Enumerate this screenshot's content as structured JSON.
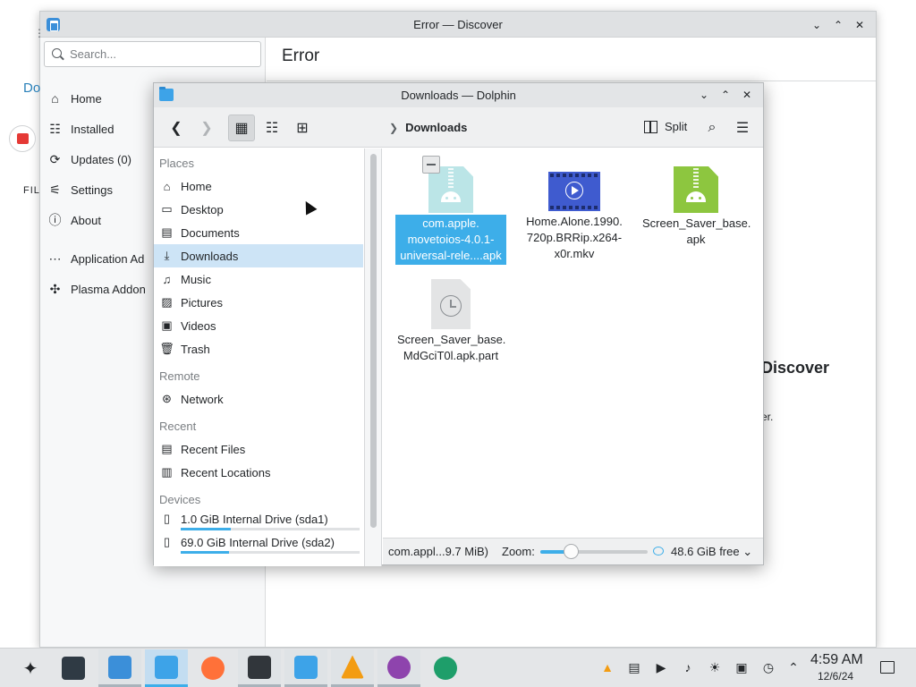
{
  "discover": {
    "title": "Error — Discover",
    "search_placeholder": "Search...",
    "header_title": "Error",
    "nav": [
      {
        "label": "Home",
        "icon": "home-icon"
      },
      {
        "label": "Installed",
        "icon": "installed-list-icon"
      },
      {
        "label": "Updates (0)",
        "icon": "updates-icon"
      },
      {
        "label": "Settings",
        "icon": "settings-icon"
      },
      {
        "label": "About",
        "icon": "about-icon"
      },
      {
        "label": "Application Ad",
        "icon": "application-addons-icon"
      },
      {
        "label": "Plasma Addon",
        "icon": "plasma-addons-icon"
      }
    ],
    "partial_left_text": "Do",
    "partial_fil_text": "FIL",
    "error_title_partial": "Discover",
    "error_sub_partial": "er."
  },
  "dolphin": {
    "title": "Downloads — Dolphin",
    "breadcrumb": "Downloads",
    "split_label": "Split",
    "places": {
      "sections": [
        "Places",
        "Remote",
        "Recent",
        "Devices"
      ],
      "places_items": [
        {
          "label": "Home",
          "icon": "home-icon"
        },
        {
          "label": "Desktop",
          "icon": "desktop-icon"
        },
        {
          "label": "Documents",
          "icon": "documents-icon"
        },
        {
          "label": "Downloads",
          "icon": "download-icon",
          "selected": true
        },
        {
          "label": "Music",
          "icon": "music-icon"
        },
        {
          "label": "Pictures",
          "icon": "pictures-icon"
        },
        {
          "label": "Videos",
          "icon": "videos-icon"
        },
        {
          "label": "Trash",
          "icon": "trash-icon"
        }
      ],
      "remote_items": [
        {
          "label": "Network",
          "icon": "network-icon"
        }
      ],
      "recent_items": [
        {
          "label": "Recent Files",
          "icon": "recent-files-icon"
        },
        {
          "label": "Recent Locations",
          "icon": "recent-locations-icon"
        }
      ],
      "devices": [
        {
          "label": "1.0 GiB Internal Drive (sda1)",
          "usage_fraction": 0.28
        },
        {
          "label": "69.0 GiB Internal Drive (sda2)",
          "usage_fraction": 0.27
        }
      ]
    },
    "files": [
      {
        "name": "com.apple.\nmovetoios-4.0.1-\nuniversal-rele....apk",
        "type": "apk",
        "selected": true
      },
      {
        "name": "Home.Alone.1990.\n720p.BRRip.x264-\nx0r.mkv",
        "type": "video"
      },
      {
        "name": "Screen_Saver_base.\napk",
        "type": "apk"
      },
      {
        "name": "Screen_Saver_base.\nMdGciT0l.apk.part",
        "type": "part"
      }
    ],
    "status": {
      "selection_info": "com.appl...9.7 MiB)",
      "zoom_label": "Zoom:",
      "zoom_fraction": 0.28,
      "free_space": "48.6 GiB free"
    }
  },
  "taskbar": {
    "apps": [
      {
        "name": "application-launcher-icon"
      },
      {
        "name": "system-settings-icon"
      },
      {
        "name": "discover-icon"
      },
      {
        "name": "dolphin-icon"
      },
      {
        "name": "firefox-icon"
      },
      {
        "name": "konsole-icon"
      },
      {
        "name": "file-manager-icon"
      },
      {
        "name": "vlc-icon"
      },
      {
        "name": "media-player-icon"
      },
      {
        "name": "app-icon"
      }
    ],
    "tray": [
      "vlc-tray-icon",
      "clipboard-icon",
      "media-play-icon",
      "volume-muted-icon",
      "brightness-icon",
      "save-icon",
      "updates-tray-icon",
      "expand-tray-icon"
    ],
    "time": "4:59 AM",
    "date": "12/6/24"
  }
}
